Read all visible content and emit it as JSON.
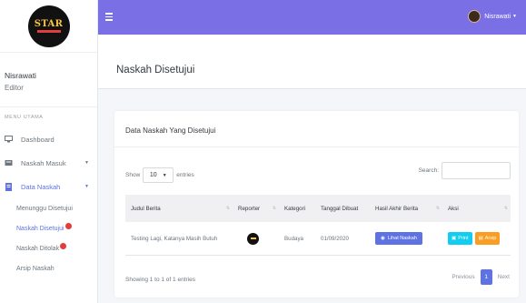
{
  "sidebar": {
    "logo_text": "STAR",
    "user_name": "Nisrawati",
    "user_role": "Editor",
    "menu_header": "MENU UTAMA",
    "items": [
      {
        "label": "Dashboard",
        "icon": "monitor-icon"
      },
      {
        "label": "Naskah Masuk",
        "icon": "inbox-icon"
      },
      {
        "label": "Data Naskah",
        "icon": "document-icon"
      }
    ],
    "sub_items": [
      {
        "label": "Menunggu Disetujui"
      },
      {
        "label": "Naskah Disetujui"
      },
      {
        "label": "Naskah Ditolak"
      },
      {
        "label": "Arsip Naskah"
      }
    ]
  },
  "topbar": {
    "user_label": "Nisrawati",
    "accent_color": "#7b6fe5"
  },
  "page": {
    "title": "Naskah Disetujui"
  },
  "card": {
    "title": "Data Naskah Yang Disetujui",
    "show_label": "Show",
    "entries_value": "10",
    "entries_label": "entries",
    "search_label": "Search:",
    "search_value": "",
    "columns": [
      "Judul Berita",
      "Reporter",
      "Kategori",
      "Tanggal Dibuat",
      "Hasil Akhir Berita",
      "Aksi"
    ],
    "rows": [
      {
        "judul": "Testing Lagi, Katanya Masih Butuh",
        "kategori": "Budaya",
        "tanggal": "01/09/2020",
        "lihat_label": "Lihat Naskah",
        "print_label": "Print",
        "arsip_label": "Arsip"
      }
    ],
    "info_text": "Showing 1 to 1 of 1 entries",
    "pager": {
      "previous": "Previous",
      "current": "1",
      "next": "Next"
    }
  }
}
